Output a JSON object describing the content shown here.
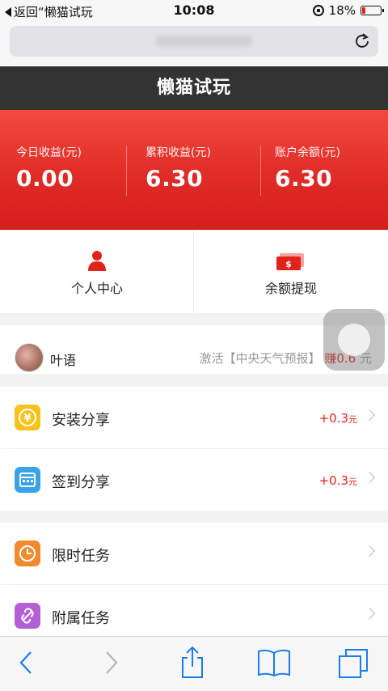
{
  "status_bar": {
    "back_label": "返回“懒猫试玩",
    "time": "10:08",
    "battery": "18%"
  },
  "title": "懒猫试玩",
  "earnings": [
    {
      "label": "今日收益(元)",
      "value": "0.00"
    },
    {
      "label": "累积收益(元)",
      "value": "6.30"
    },
    {
      "label": "账户余额(元)",
      "value": "6.30"
    }
  ],
  "quick_actions": {
    "profile_label": "个人中心",
    "withdraw_label": "余额提现"
  },
  "news": {
    "user": "叶语",
    "prefix": "激活【中央天气预报】",
    "earn": "赚0.6",
    "unit": "元"
  },
  "tasks": [
    {
      "title": "安装分享",
      "reward": "+0.3",
      "unit": "元",
      "color": "#f7c21a"
    },
    {
      "title": "签到分享",
      "reward": "+0.3",
      "unit": "元",
      "color": "#3aa3e8"
    },
    {
      "title": "限时任务",
      "reward": "",
      "unit": "",
      "color": "#f08a2c"
    },
    {
      "title": "附属任务",
      "reward": "",
      "unit": "",
      "color": "#b55fd6"
    }
  ],
  "colors": {
    "brand_red": "#e2231a",
    "title_bar": "#333333"
  },
  "icons": [
    "reload-icon",
    "back-icon",
    "forward-icon",
    "share-icon",
    "bookmarks-icon",
    "tabs-icon",
    "person-icon",
    "cash-icon",
    "yen-icon",
    "calendar-icon",
    "clock-icon",
    "link-icon"
  ]
}
